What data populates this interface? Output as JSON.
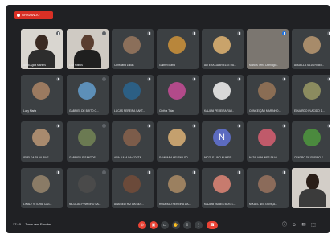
{
  "recording_label": "GRAVANDO",
  "meeting": {
    "time": "17:19",
    "title": "Tocar nas Escolas"
  },
  "tiles": [
    {
      "name": "Anna Agda Martins",
      "kind": "video"
    },
    {
      "name": "Luiz Mattos",
      "kind": "video2"
    },
    {
      "name": "Christiana Lucas",
      "kind": "avatar",
      "color": "#8b6f5a"
    },
    {
      "name": "Gabriel Maria",
      "kind": "avatar",
      "color": "#b8863b"
    },
    {
      "name": "ALTERA GABRIELLE SA...",
      "kind": "avatar",
      "color": "#c9a36b"
    },
    {
      "name": "Marcos Terra Domingo...",
      "kind": "dark"
    },
    {
      "name": "ANGELLA SILVA RIBEI...",
      "kind": "avatar",
      "color": "#a78b6a"
    },
    {
      "name": "Lucy Maria",
      "kind": "avatar",
      "color": "#9b7a60"
    },
    {
      "name": "GABRIEL DE BRITO O...",
      "kind": "avatar",
      "color": "#5d8fb8"
    },
    {
      "name": "LUCAS PEREIRA SANT...",
      "kind": "avatar",
      "color": "#2c5f84"
    },
    {
      "name": "Cinthia Tolan",
      "kind": "avatar",
      "color": "#b24a8a"
    },
    {
      "name": "KAUANI PEREIRA RAI...",
      "kind": "avatar",
      "color": "#d8d8d8"
    },
    {
      "name": "CONCEIÇÃO MARINHO...",
      "kind": "avatar",
      "color": "#8a6d54"
    },
    {
      "name": "EDUARDO PLACIDO D...",
      "kind": "avatar",
      "color": "#8b8b5f"
    },
    {
      "name": "ISLEI DA SILVA RIVE...",
      "kind": "avatar",
      "color": "#a88a6e"
    },
    {
      "name": "GABRIELLE SANTOS...",
      "kind": "avatar",
      "color": "#6b7a52"
    },
    {
      "name": "ANA JULIA DA COSTA...",
      "kind": "avatar",
      "color": "#7c5c4a"
    },
    {
      "name": "SAMUARA HELENA SO...",
      "kind": "avatar",
      "color": "#c4a06e"
    },
    {
      "name": "NICOLE LINO NUNES",
      "kind": "letter",
      "color": "#5c6bc0",
      "letter": "N"
    },
    {
      "name": "NATALIA NUNES SILVA...",
      "kind": "avatar",
      "color": "#c05a6a"
    },
    {
      "name": "CENTRO DE ENSINO F...",
      "kind": "avatar",
      "color": "#4b8a3e"
    },
    {
      "name": "LINALY VITORIA CAS...",
      "kind": "avatar",
      "color": "#8a7b66"
    },
    {
      "name": "NICOLAS PINHEIRO SA...",
      "kind": "avatar",
      "color": "#4a4a4a"
    },
    {
      "name": "ANA BEATRIZ DA SILV...",
      "kind": "avatar",
      "color": "#6b4a3a"
    },
    {
      "name": "RODRIGO PEREIRA DA...",
      "kind": "avatar",
      "color": "#9b8060"
    },
    {
      "name": "KAUANI NUNES BOS S...",
      "kind": "avatar",
      "color": "#c77b6e"
    },
    {
      "name": "MIKAEL NEL GONÇA...",
      "kind": "avatar",
      "color": "#8b6b5a"
    },
    {
      "name": "",
      "kind": "video3"
    }
  ],
  "controls": [
    {
      "icon": "mic-off-icon",
      "glyph": "⊘"
    },
    {
      "icon": "camera-off-icon",
      "glyph": "▣"
    },
    {
      "icon": "caption-icon",
      "glyph": "▭"
    },
    {
      "icon": "raise-hand-icon",
      "glyph": "✋"
    },
    {
      "icon": "present-icon",
      "glyph": "⇧"
    },
    {
      "icon": "more-icon",
      "glyph": "⋮"
    }
  ],
  "right_icons": [
    {
      "icon": "info-icon",
      "glyph": "ⓘ"
    },
    {
      "icon": "people-icon",
      "glyph": "☺"
    },
    {
      "icon": "chat-icon",
      "glyph": "✉"
    },
    {
      "icon": "activities-icon",
      "glyph": "⬚"
    }
  ],
  "colors": {
    "bg": "#202124",
    "tile": "#3c4043",
    "end": "#ea4335"
  }
}
